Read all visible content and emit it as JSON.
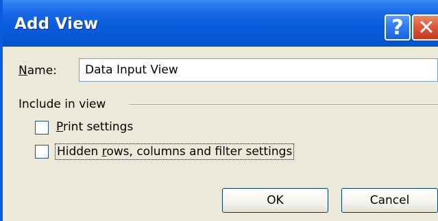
{
  "dialog": {
    "title": "Add View",
    "help_glyph": "?",
    "close_glyph": "✕"
  },
  "name_field": {
    "label_accel": "N",
    "label_rest": "ame:",
    "value": "Data Input View"
  },
  "include_group": {
    "label": "Include in view",
    "print_settings": {
      "label_accel": "P",
      "label_rest": "rint settings",
      "checked": false
    },
    "hidden_rows": {
      "label_before": "Hidden ",
      "label_accel": "r",
      "label_rest": "ows, columns and filter settings",
      "checked": false
    }
  },
  "buttons": {
    "ok": "OK",
    "cancel": "Cancel"
  },
  "colors": {
    "title_bar": "#0a5ddc",
    "dialog_bg": "#ece9d8",
    "close_button": "#dc5b3a"
  }
}
